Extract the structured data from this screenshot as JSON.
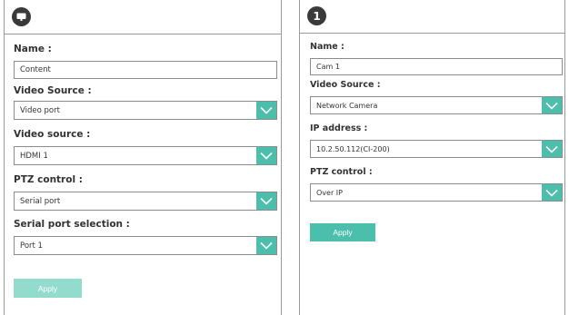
{
  "left_panel": {
    "badge_icon": "monitor-icon",
    "name_label": "Name :",
    "name_value": "Content",
    "video_source_label": "Video Source :",
    "video_source_value": "Video port",
    "video_source2_label": "Video source :",
    "video_source2_value": "HDMI 1",
    "ptz_label": "PTZ control :",
    "ptz_value": "Serial port",
    "serial_port_label": "Serial port selection :",
    "serial_port_value": "Port 1",
    "apply_label": "Apply"
  },
  "right_panel": {
    "badge_text": "1",
    "name_label": "Name :",
    "name_value": "Cam 1",
    "video_source_label": "Video Source :",
    "video_source_value": "Network Camera",
    "ip_label": "IP address :",
    "ip_value": "10.2.50.112(CI-200)",
    "ptz_label": "PTZ control :",
    "ptz_value": "Over IP",
    "apply_label": "Apply"
  },
  "colors": {
    "accent": "#4bbfab",
    "accent_disabled": "#93dccd",
    "badge": "#3a3a3a"
  }
}
